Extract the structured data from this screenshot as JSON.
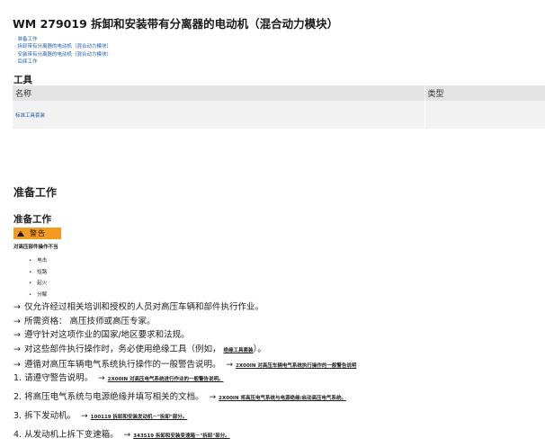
{
  "page": {
    "title": "WM 279019 拆卸和安装带有分离器的电动机（混合动力模块）"
  },
  "toc": {
    "items": [
      "· 准备工作",
      "· 拆卸带有分离器的电动机（混合动力模块）",
      "· 安装带有分离器的电动机（混合动力模块）",
      "· 后续工作"
    ]
  },
  "tools": {
    "heading": "工具",
    "col_name": "名称",
    "col_type": "类型",
    "rows": [
      {
        "name": "标准工具套装",
        "type": ""
      }
    ]
  },
  "prep": {
    "heading_main": "准备工作",
    "heading_sub": "准备工作",
    "warning_label": "警告",
    "warning_title": "对高压部件操作不当",
    "hazards": [
      "电击",
      "短路",
      "起火",
      "分解"
    ],
    "notes": [
      {
        "text": "仅允许经过相关培训和授权的人员对高压车辆和部件执行作业。",
        "link": ""
      },
      {
        "text": "所需资格：  高压技师或高压专家。",
        "link": ""
      },
      {
        "text": "遵守针对这项作业的国家/地区要求和法规。",
        "link": ""
      },
      {
        "text": "对这些部件执行操作时，务必使用绝缘工具（例如，",
        "link": "绝缘工具套装",
        "suffix": "）。"
      },
      {
        "text": "遵循对高压车辆电气系统执行操作的一般警告说明。",
        "link": "2X00IN 对高压车辆电气系统执行操作的一般警告说明",
        "suffix": ""
      }
    ]
  },
  "steps": [
    {
      "text": "1. 请遵守警告说明。",
      "link": "2X00IN 对高压电气系统进行作业的一般警告说明。"
    },
    {
      "text": "2. 将高压电气系统与电源绝缘并填写相关的文档。",
      "link": "2X00IN 将高压电气系统与电源绝缘/启动高压电气系统。"
    },
    {
      "text": "3. 拆下发动机。",
      "link": "100119 拆卸和安装发动机－\"拆卸\"部分。"
    },
    {
      "text": "4. 从发动机上拆下变速箱。",
      "link": "343519 拆卸和安装变速箱－\"拆卸\"部分。"
    }
  ]
}
